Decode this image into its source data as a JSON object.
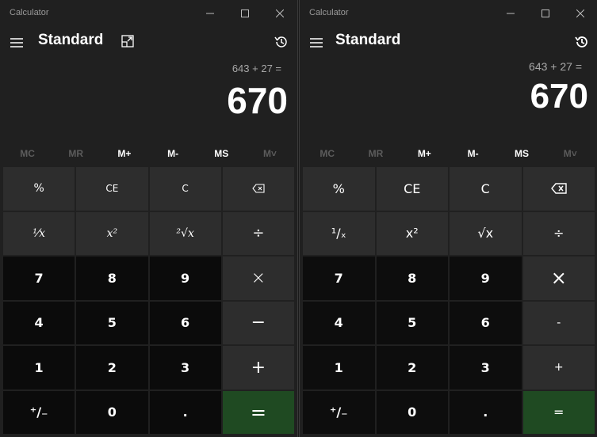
{
  "windows": [
    {
      "app_title": "Calculator",
      "mode_title": "Standard",
      "expression": "643 + 27 =",
      "result": "670",
      "memory": [
        "MC",
        "MR",
        "M+",
        "M-",
        "MS",
        "M˅"
      ],
      "keys": {
        "percent": "%",
        "ce": "CE",
        "clear": "C",
        "reciprocal": "¹⁄x",
        "square": "x²",
        "sqrt": "²√x",
        "divide": "÷",
        "d7": "7",
        "d8": "8",
        "d9": "9",
        "multiply": "×",
        "d4": "4",
        "d5": "5",
        "d6": "6",
        "minus": "−",
        "d1": "1",
        "d2": "2",
        "d3": "3",
        "plus": "+",
        "negate": "⁺/₋",
        "d0": "0",
        "decimal": ".",
        "equals": "="
      }
    },
    {
      "app_title": "Calculator",
      "mode_title": "Standard",
      "expression": "643 + 27 =",
      "result": "670",
      "memory": [
        "MC",
        "MR",
        "M+",
        "M-",
        "MS",
        "M˅"
      ],
      "keys": {
        "percent": "%",
        "ce": "CE",
        "clear": "C",
        "reciprocal": "¹/ₓ",
        "square": "x²",
        "sqrt": "√x",
        "divide": "÷",
        "d7": "7",
        "d8": "8",
        "d9": "9",
        "multiply": "×",
        "d4": "4",
        "d5": "5",
        "d6": "6",
        "minus": "-",
        "d1": "1",
        "d2": "2",
        "d3": "3",
        "plus": "+",
        "negate": "⁺/₋",
        "d0": "0",
        "decimal": ".",
        "equals": "="
      }
    }
  ],
  "colors": {
    "background": "#202020",
    "function_key": "#2d2d2d",
    "number_key": "#0b0b0b",
    "equals_key": "#1f4a22",
    "muted_text": "#a8a8a8"
  },
  "icons": [
    "hamburger-menu-icon",
    "keep-on-top-icon",
    "history-icon",
    "minimize-icon",
    "maximize-icon",
    "close-icon",
    "backspace-icon"
  ]
}
